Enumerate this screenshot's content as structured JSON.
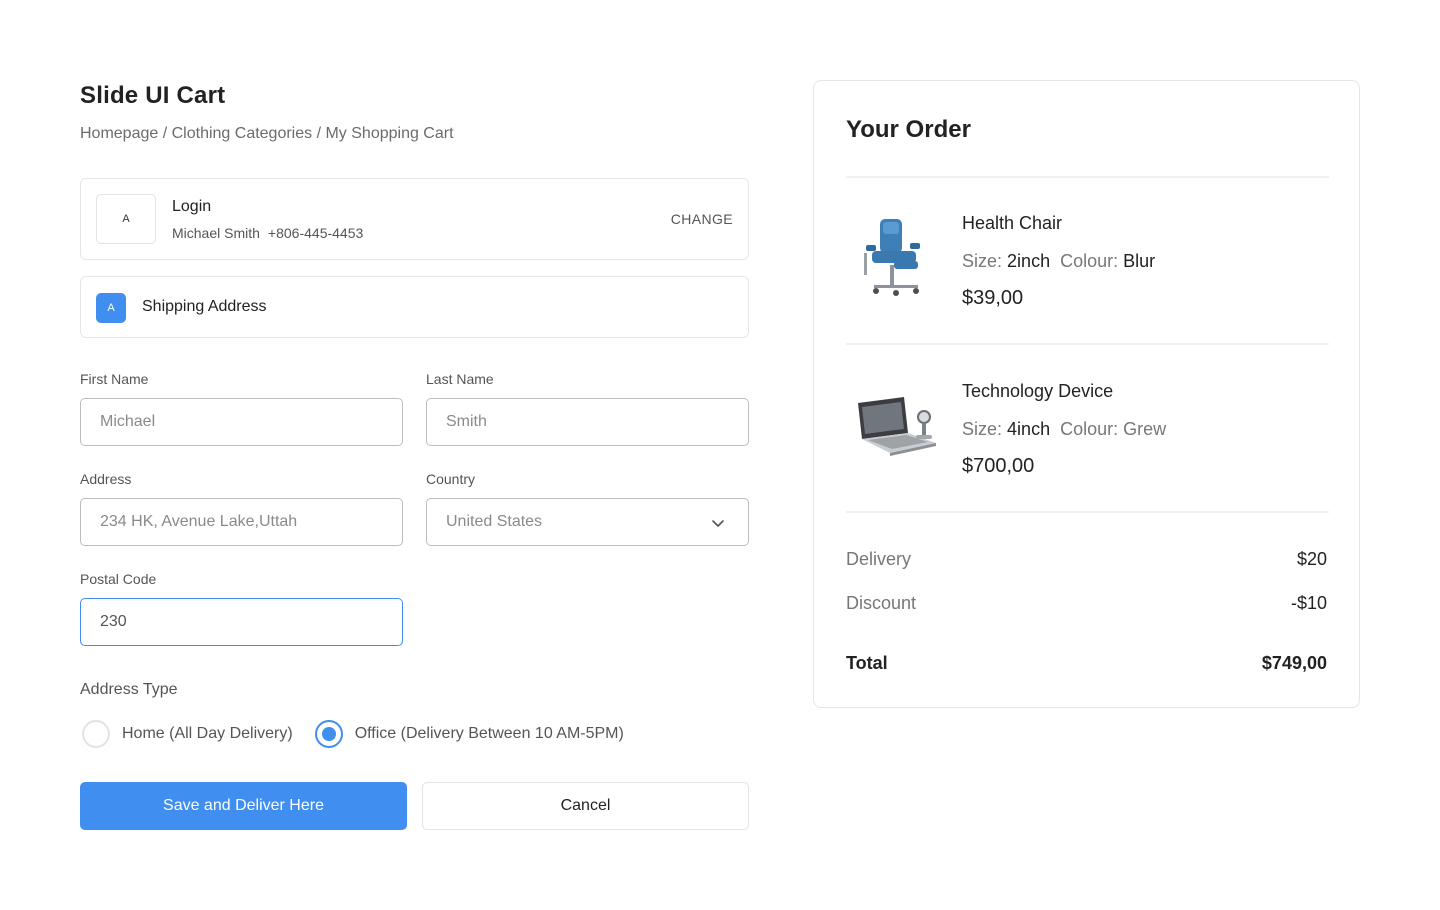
{
  "header": {
    "title": "Slide UI Cart",
    "breadcrumb": "Homepage / Clothing Categories / My Shopping Cart"
  },
  "login": {
    "avatar_letter": "A",
    "title": "Login",
    "name": "Michael Smith",
    "phone": "+806-445-4453",
    "change_label": "CHANGE"
  },
  "shipping": {
    "badge_letter": "A",
    "title": "Shipping Address"
  },
  "form": {
    "first_name": {
      "label": "First Name",
      "value": "Michael"
    },
    "last_name": {
      "label": "Last Name",
      "value": "Smith"
    },
    "address": {
      "label": "Address",
      "value": "234 HK, Avenue Lake,Uttah"
    },
    "country": {
      "label": "Country",
      "value": "United States"
    },
    "postal_code": {
      "label": "Postal Code",
      "value": "230"
    }
  },
  "address_type": {
    "label": "Address Type",
    "options": [
      {
        "label": "Home (All Day Delivery)",
        "checked": false
      },
      {
        "label": "Office (Delivery Between 10 AM-5PM)",
        "checked": true
      }
    ]
  },
  "actions": {
    "save_label": "Save and Deliver Here",
    "cancel_label": "Cancel"
  },
  "order": {
    "title": "Your Order",
    "items": [
      {
        "name": "Health Chair",
        "size_label": "Size:",
        "size": "2inch",
        "colour_label": "Colour:",
        "colour": "Blur",
        "price": "$39,00",
        "icon": "chair-image"
      },
      {
        "name": "Technology Device",
        "size_label": "Size:",
        "size": "4inch",
        "colour_label": "Colour:",
        "colour": "Grew",
        "price": "$700,00",
        "icon": "device-image"
      }
    ],
    "delivery_label": "Delivery",
    "delivery_value": "$20",
    "discount_label": "Discount",
    "discount_value": "-$10",
    "total_label": "Total",
    "total_value": "$749,00"
  },
  "colors": {
    "accent": "#3f8ef0",
    "border": "#e6e6e6",
    "text": "#222222",
    "muted": "#777777"
  }
}
